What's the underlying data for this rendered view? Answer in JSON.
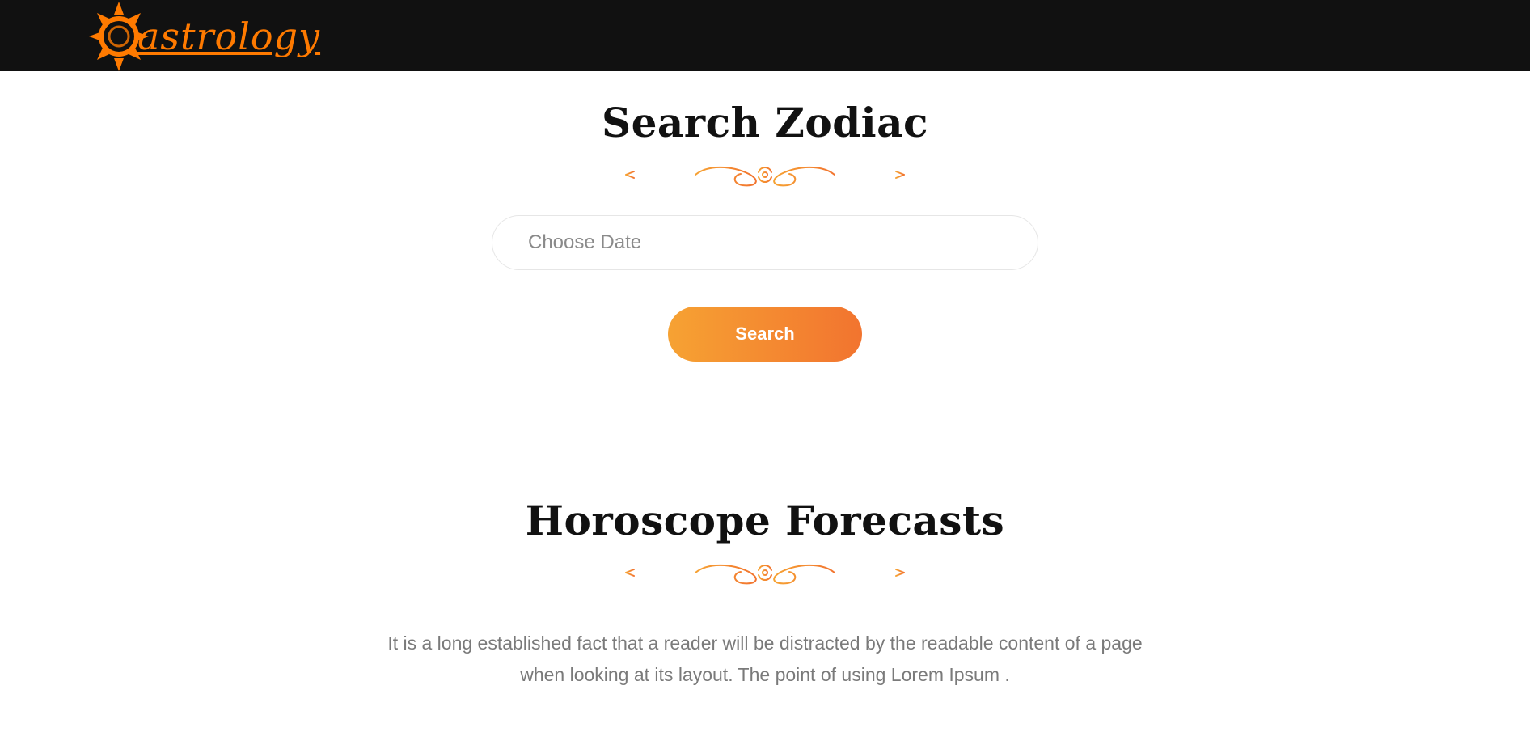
{
  "header": {
    "brand": "astrology",
    "brand_color": "#ff7a00",
    "bg_color": "#111111"
  },
  "search_zodiac": {
    "title": "Search Zodiac",
    "date_input": {
      "placeholder": "Choose Date",
      "value": ""
    },
    "search_button_label": "Search"
  },
  "horoscope": {
    "title": "Horoscope Forecasts",
    "description": "It is a long established fact that a reader will be distracted by the readable content of a page when looking at its layout. The point of using Lorem Ipsum ."
  },
  "colors": {
    "accent_gradient_start": "#f6a233",
    "accent_gradient_end": "#f2742f",
    "ornament": "#f28a32"
  },
  "icons": {
    "logo_sun": "sun-icon",
    "divider": "ornament-divider-icon"
  }
}
